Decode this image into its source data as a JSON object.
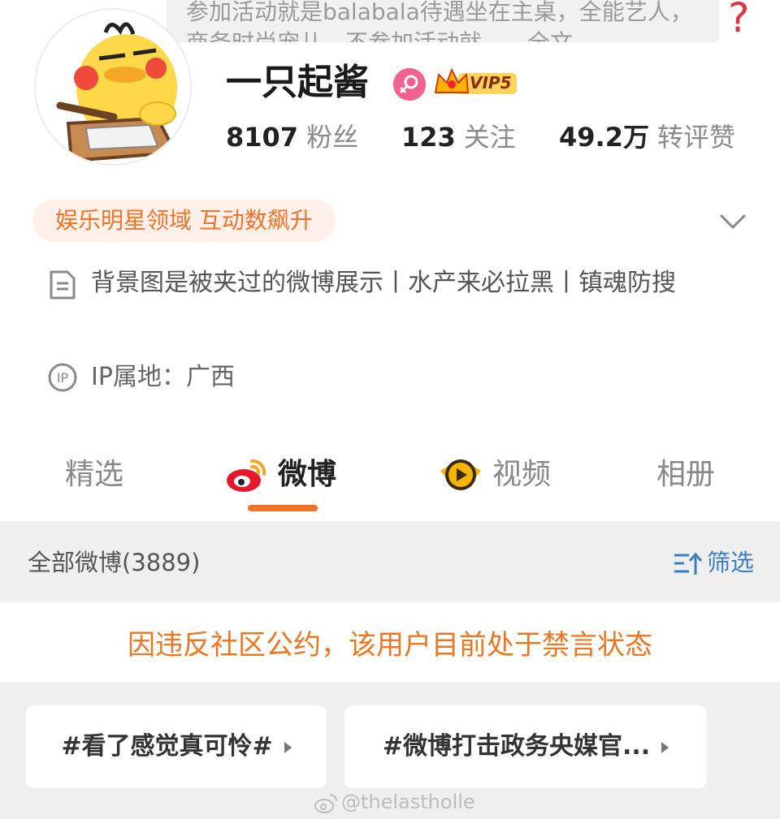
{
  "banner": {
    "note": "参加活动就是balabala待遇坐在主桌，全能艺人，商务时尚宠儿，不参加活动就……全文"
  },
  "profile": {
    "username": "一只起酱",
    "vip_label": "VIP5",
    "stats": {
      "fans_count": "8107",
      "fans_label": "粉丝",
      "follow_count": "123",
      "follow_label": "关注",
      "likes_count": "49.2万",
      "likes_label": "转评赞"
    },
    "domain_tag": "娱乐明星领域 互动数飙升",
    "bio": "背景图是被夹过的微博展示丨水产来必拉黑丨镇魂防搜",
    "ip_location": "IP属地：广西"
  },
  "tabs": [
    {
      "label": "精选",
      "active": false
    },
    {
      "label": "微博",
      "active": true
    },
    {
      "label": "视频",
      "active": false
    },
    {
      "label": "相册",
      "active": false
    }
  ],
  "feed": {
    "post_count_label": "全部微博(3889)",
    "filter_label": "筛选",
    "ban_notice": "因违反社区公约，该用户目前处于禁言状态",
    "topics": [
      "#看了感觉真可怜#",
      "#微博打击政务央媒官..."
    ]
  },
  "watermark": "@thelastholle",
  "colors": {
    "accent": "#f0732a",
    "ban_text": "#eb7722",
    "filter_blue": "#3a7fc0",
    "help_red": "#d9363e",
    "tag_bg": "#fff1ea"
  },
  "icons": [
    "help-icon",
    "gender-female-icon",
    "vip-crown-icon",
    "chevron-down-icon",
    "document-icon",
    "ip-location-icon",
    "weibo-logo-icon",
    "video-play-icon",
    "filter-sort-icon",
    "weibo-watermark-icon"
  ]
}
